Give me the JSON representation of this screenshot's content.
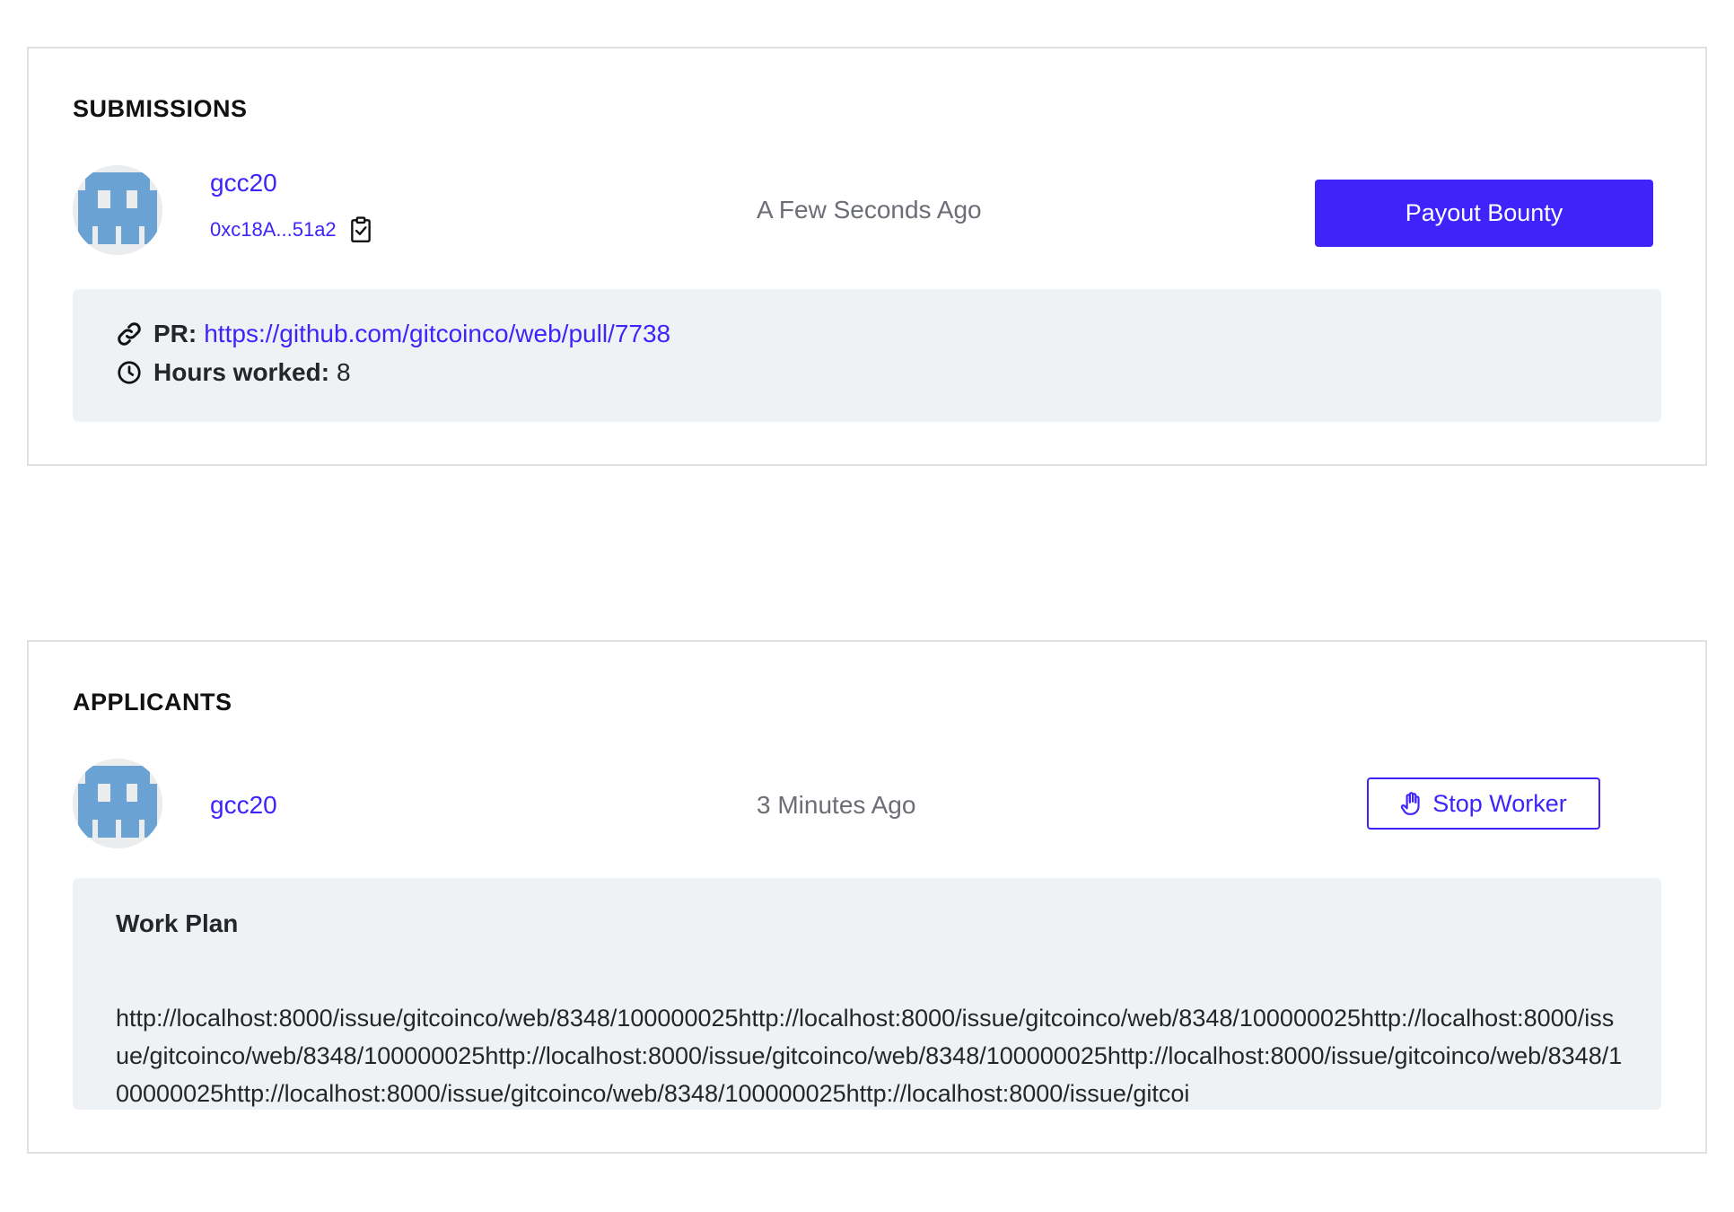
{
  "submissions": {
    "title": "SUBMISSIONS",
    "user": "gcc20",
    "address": "0xc18A...51a2",
    "time": "A Few Seconds Ago",
    "button": "Payout Bounty",
    "pr_label": "PR:",
    "pr_url": "https://github.com/gitcoinco/web/pull/7738",
    "hours_label": "Hours worked:",
    "hours_value": "8"
  },
  "applicants": {
    "title": "APPLICANTS",
    "user": "gcc20",
    "time": "3 Minutes Ago",
    "button": "Stop Worker",
    "workplan_title": "Work Plan",
    "workplan_text": "http://localhost:8000/issue/gitcoinco/web/8348/100000025http://localhost:8000/issue/gitcoinco/web/8348/100000025http://localhost:8000/issue/gitcoinco/web/8348/100000025http://localhost:8000/issue/gitcoinco/web/8348/100000025http://localhost:8000/issue/gitcoinco/web/8348/100000025http://localhost:8000/issue/gitcoinco/web/8348/100000025http://localhost:8000/issue/gitcoi"
  },
  "colors": {
    "accent": "#3e24fb",
    "panel_border": "#dfe1e4",
    "detail_bg": "#eff2f4",
    "avatar_blue": "#6aa2d4"
  },
  "icons": {
    "copy": "clipboard-check-icon",
    "link": "link-icon",
    "clock": "clock-icon",
    "hand": "hand-stop-icon"
  }
}
